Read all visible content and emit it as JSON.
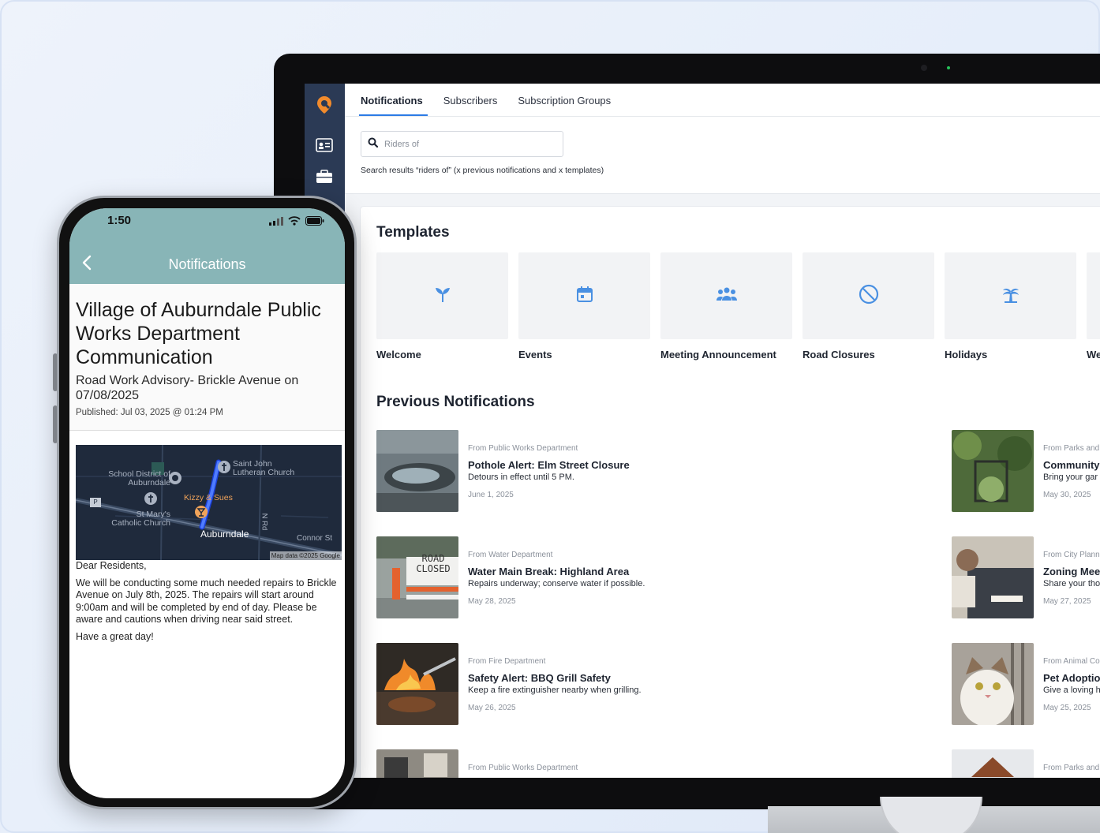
{
  "colors": {
    "rail": "#2b3a55",
    "tab_active": "#2c7be5",
    "icon_blue": "#4a90e2",
    "phone_header": "#88b5b7",
    "logo_orange": "#f28b2c"
  },
  "sidebar": {
    "icons": [
      "brand-logo-icon",
      "contact-card-icon",
      "briefcase-icon"
    ]
  },
  "tabs": [
    {
      "label": "Notifications",
      "active": true
    },
    {
      "label": "Subscribers",
      "active": false
    },
    {
      "label": "Subscription Groups",
      "active": false
    }
  ],
  "search": {
    "placeholder": "Riders of",
    "results_text": "Search results “riders of” (x previous notifications and x templates)"
  },
  "templates_section": {
    "title": "Templates",
    "items": [
      {
        "label": "Welcome",
        "icon": "sprout-icon"
      },
      {
        "label": "Events",
        "icon": "calendar-icon"
      },
      {
        "label": "Meeting Announcement",
        "icon": "people-icon"
      },
      {
        "label": "Road Closures",
        "icon": "no-entry-icon"
      },
      {
        "label": "Holidays",
        "icon": "palm-tree-icon"
      },
      {
        "label": "We",
        "icon": ""
      }
    ]
  },
  "previous_section": {
    "title": "Previous Notifications",
    "items": [
      {
        "from": "From Public Works Department",
        "title": "Pothole Alert: Elm Street Closure",
        "desc": "Detours in effect until 5 PM.",
        "date": "June 1, 2025"
      },
      {
        "from": "From Parks and",
        "title": "Community (",
        "desc": "Bring your gar",
        "date": "May 30, 2025"
      },
      {
        "from": "From Water Department",
        "title": "Water Main Break: Highland Area",
        "desc": "Repairs underway; conserve water if possible.",
        "date": "May 28, 2025"
      },
      {
        "from": "From City Plann",
        "title": "Zoning Meet",
        "desc": "Share your tho",
        "date": "May 27, 2025"
      },
      {
        "from": "From Fire Department",
        "title": "Safety Alert: BBQ Grill Safety",
        "desc": "Keep a fire extinguisher nearby when grilling.",
        "date": "May 26, 2025"
      },
      {
        "from": "From Animal Co",
        "title": "Pet Adoptior",
        "desc": "Give a loving h",
        "date": "May 25, 2025"
      },
      {
        "from": "From Public Works Department",
        "title": "",
        "desc": "",
        "date": ""
      },
      {
        "from": "From Parks and",
        "title": "",
        "desc": "",
        "date": ""
      }
    ],
    "road_sign_text": [
      "ROAD",
      "CLOSED"
    ]
  },
  "phone": {
    "time": "1:50",
    "header_title": "Notifications",
    "org_title": "Village of Auburndale Public Works Department Communication",
    "subject": "Road Work Advisory- Brickle Avenue on 07/08/2025",
    "published": "Published: Jul 03, 2025 @ 01:24 PM",
    "map": {
      "labels": {
        "school": "School District of Auburndale",
        "saint_john": "Saint John Lutheran Church",
        "kizzy": "Kizzy & Sues",
        "st_marys": "St Mary's Catholic Church",
        "town": "Auburndale",
        "n_rd": "N Rd",
        "connor": "Connor St",
        "attribution": "Map data ©2025 Google",
        "parking": "P"
      }
    },
    "body": {
      "greeting": "Dear Residents,",
      "paragraph": "We will be conducting some much needed repairs to Brickle Avenue on July 8th, 2025. The repairs will start around 9:00am and will be completed by end of day. Please be aware and cautions when driving near said street.",
      "signoff": "Have a great day!"
    }
  }
}
